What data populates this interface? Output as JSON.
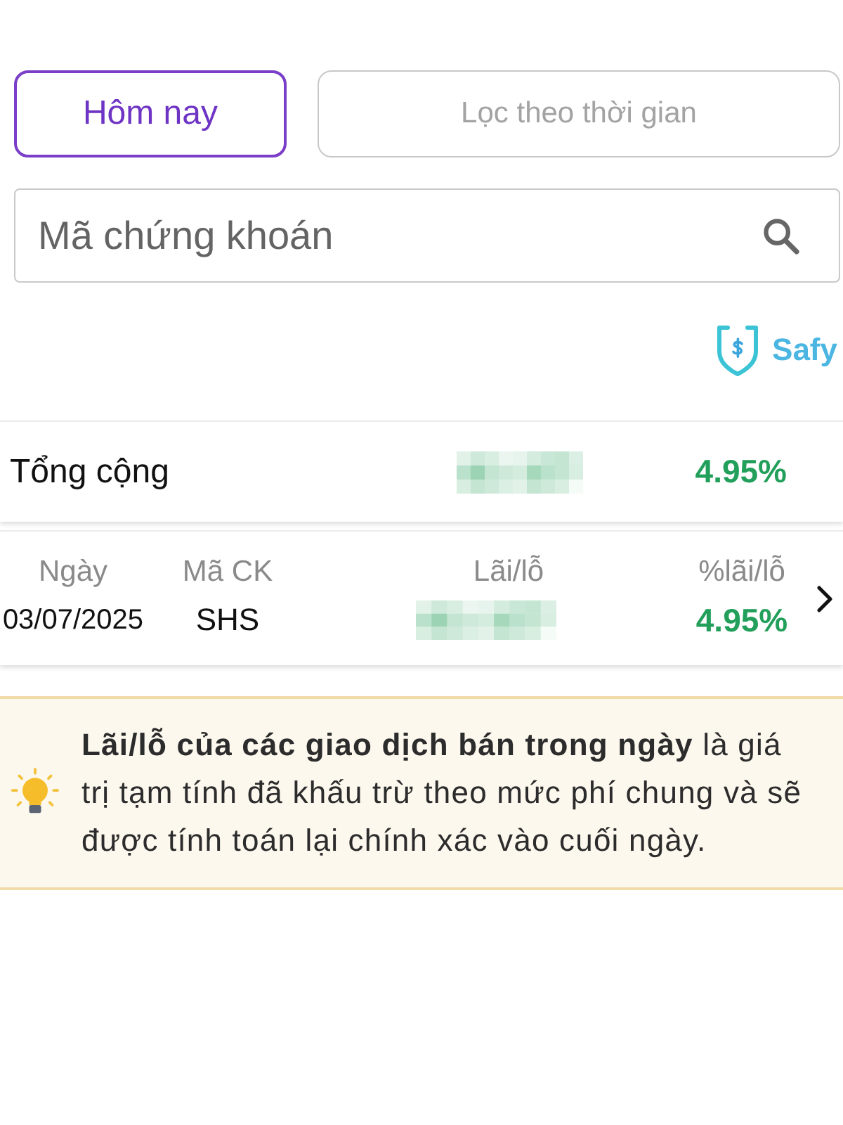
{
  "tabs": [
    {
      "label": "Hôm nay",
      "selected": true
    },
    {
      "label": "Lọc theo thời gian",
      "selected": false
    }
  ],
  "search": {
    "placeholder": "Mã chứng khoán"
  },
  "brand": {
    "name": "Safy"
  },
  "total": {
    "label": "Tổng cộng",
    "percent": "4.95%",
    "positive": true
  },
  "table": {
    "columns": [
      "Ngày",
      "Mã CK",
      "Lãi/lỗ",
      "%lãi/lỗ"
    ],
    "rows": [
      {
        "date": "03/07/2025",
        "symbol": "SHS",
        "percent": "4.95%",
        "positive": true
      }
    ]
  },
  "note": {
    "text": "**Lãi/lỗ của các giao dịch bán trong ngày** là giá trị tạm tính đã khấu trừ theo mức phí chung và sẽ được tính toán lại chính xác vào cuối ngày."
  }
}
